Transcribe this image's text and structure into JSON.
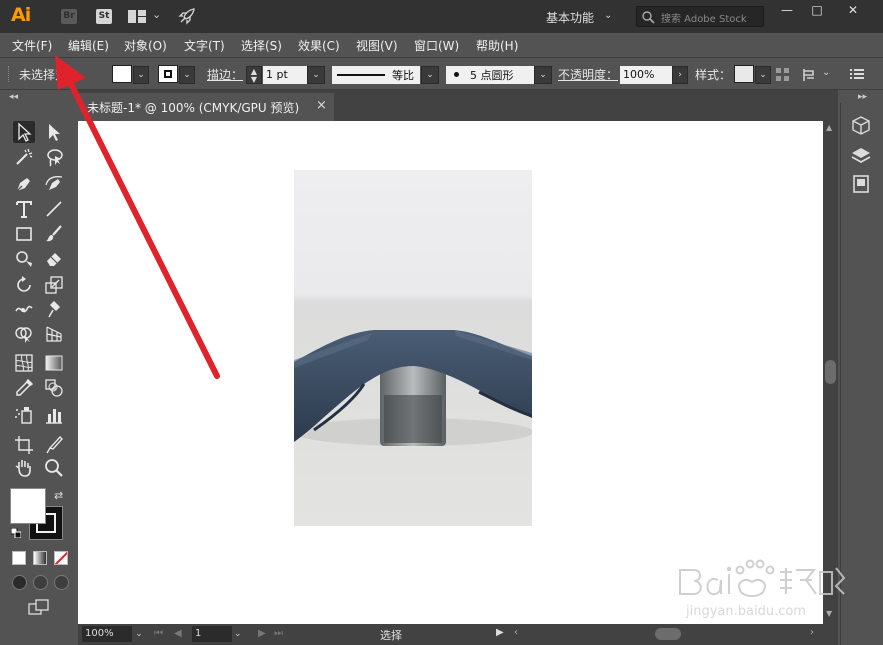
{
  "titlebar": {
    "app_logo": "Ai",
    "bridge_badge": "Br",
    "stock_badge": "St",
    "workspace": "基本功能",
    "stock_search_placeholder": "搜索 Adobe Stock",
    "minimize": "—",
    "maximize": "□",
    "close": "✕"
  },
  "menu": {
    "items": [
      {
        "label": "文件(F)"
      },
      {
        "label": "编辑(E)"
      },
      {
        "label": "对象(O)"
      },
      {
        "label": "文字(T)"
      },
      {
        "label": "选择(S)"
      },
      {
        "label": "效果(C)"
      },
      {
        "label": "视图(V)"
      },
      {
        "label": "窗口(W)"
      },
      {
        "label": "帮助(H)"
      }
    ]
  },
  "control": {
    "selection_status": "未选择对象",
    "stroke_label": "描边：",
    "stroke_weight": "1 pt",
    "profile_label": "等比",
    "brush_label": "5 点圆形",
    "opacity_label": "不透明度：",
    "opacity_value": "100%",
    "style_label": "样式："
  },
  "document": {
    "tab_title": "未标题-1* @ 100% (CMYK/GPU 预览)",
    "tab_close": "×"
  },
  "status": {
    "zoom": "100%",
    "page": "1",
    "tool": "选择"
  },
  "watermark": {
    "url": "jingyan.baidu.com"
  },
  "colors": {
    "annotation_arrow": "#e0222c",
    "ai_logo": "#ff9a00",
    "panel_bg": "#535353",
    "titlebar_bg": "#323232"
  }
}
